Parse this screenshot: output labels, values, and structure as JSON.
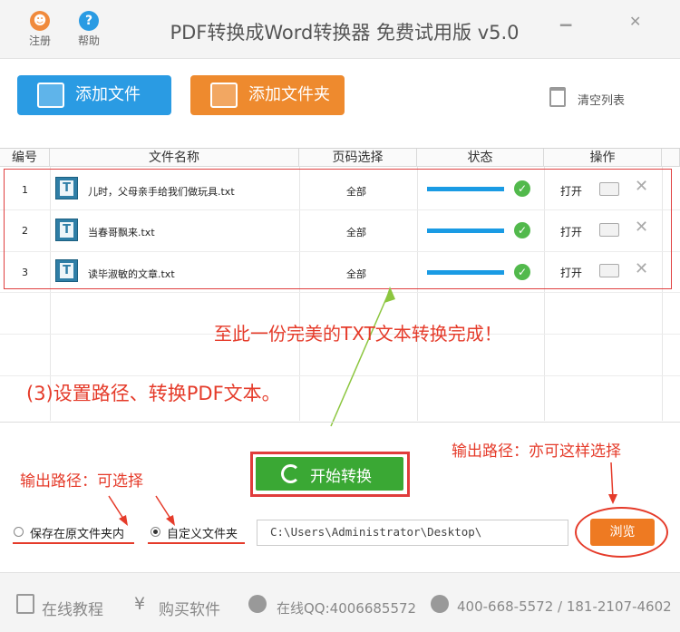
{
  "titlebar": {
    "register_label": "注册",
    "help_label": "帮助",
    "title": "PDF转换成Word转换器 免费试用版 v5.0",
    "minimize_glyph": "▁",
    "close_glyph": "✕"
  },
  "toolbar": {
    "add_file_label": "添加文件",
    "add_folder_label": "添加文件夹",
    "clear_list_label": "清空列表"
  },
  "table": {
    "headers": [
      "编号",
      "文件名称",
      "页码选择",
      "状态",
      "操作"
    ],
    "rows": [
      {
        "no": "1",
        "name": "儿时，父母亲手给我们做玩具.txt",
        "pages": "全部",
        "progress": 1.0,
        "action": "打开"
      },
      {
        "no": "2",
        "name": "当春哥飘来.txt",
        "pages": "全部",
        "progress": 1.0,
        "action": "打开"
      },
      {
        "no": "3",
        "name": "读毕淑敏的文章.txt",
        "pages": "全部",
        "progress": 1.0,
        "action": "打开"
      }
    ]
  },
  "annotations": {
    "done_note": "至此一份完美的TXT文本转换完成！",
    "step_note": "(3)设置路径、转换PDF文本。",
    "output_note_left": "输出路径：可选择",
    "output_note_right": "输出路径：亦可这样选择"
  },
  "convert": {
    "start_label": "开始转换"
  },
  "output": {
    "option_original_label": "保存在原文件夹内",
    "option_custom_label": "自定义文件夹",
    "selected": "custom",
    "path_value": "C:\\Users\\Administrator\\Desktop\\",
    "browse_label": "浏览"
  },
  "footer": {
    "tutorial_label": "在线教程",
    "buy_label": "购买软件",
    "qq_label": "在线QQ:4006685572",
    "phone_label": "400-668-5572 / 181-2107-4602"
  },
  "colors": {
    "blue_button": "#2a9be3",
    "orange_button": "#ee8a2e",
    "green_button": "#3aa834",
    "annotation_red": "#e53b2a",
    "progress_blue": "#1a9be4"
  }
}
